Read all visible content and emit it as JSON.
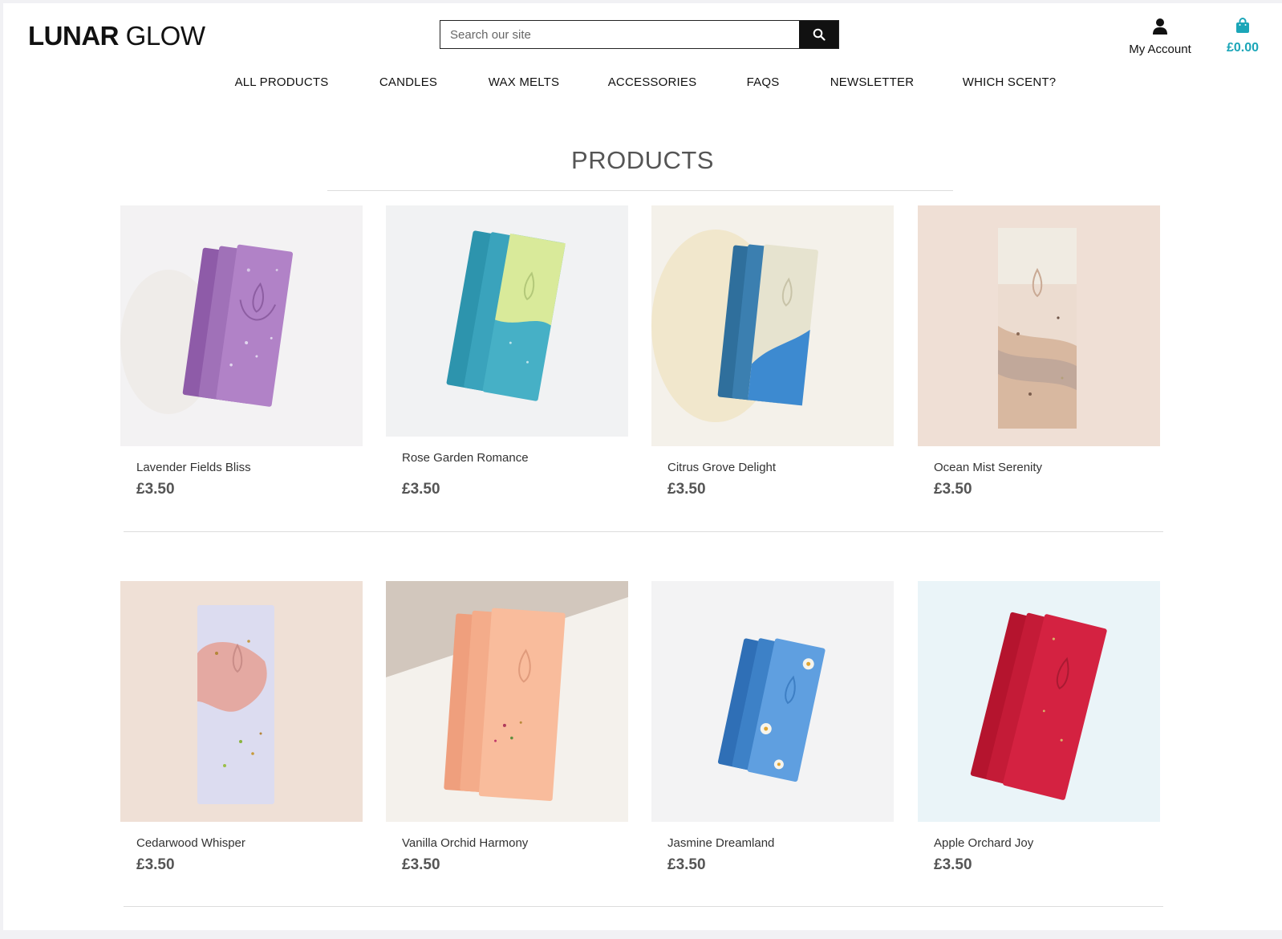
{
  "header": {
    "logo_bold": "LUNAR",
    "logo_light": "GLOW",
    "search_placeholder": "Search our site",
    "search_icon": "search-icon",
    "account_label": "My Account",
    "account_icon": "user-icon",
    "cart_total": "£0.00",
    "cart_icon": "shopping-bag-icon",
    "accent_color": "#1ba6b8"
  },
  "nav": {
    "items": [
      "ALL PRODUCTS",
      "CANDLES",
      "WAX MELTS",
      "ACCESSORIES",
      "FAQS",
      "NEWSLETTER",
      "WHICH SCENT?"
    ]
  },
  "main": {
    "title": "PRODUCTS",
    "products": [
      {
        "name": "Lavender Fields Bliss",
        "price": "£3.50"
      },
      {
        "name": "Rose Garden Romance",
        "price": "£3.50"
      },
      {
        "name": "Citrus Grove Delight",
        "price": "£3.50"
      },
      {
        "name": "Ocean Mist Serenity",
        "price": "£3.50"
      },
      {
        "name": "Cedarwood Whisper",
        "price": "£3.50"
      },
      {
        "name": "Vanilla Orchid Harmony",
        "price": "£3.50"
      },
      {
        "name": "Jasmine Dreamland",
        "price": "£3.50"
      },
      {
        "name": "Apple Orchard Joy",
        "price": "£3.50"
      }
    ]
  }
}
